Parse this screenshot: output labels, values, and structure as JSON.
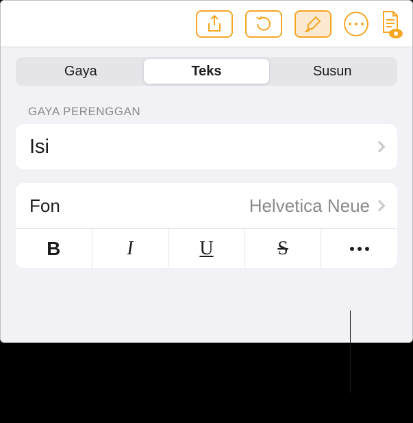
{
  "toolbar": {
    "share_icon": "share-icon",
    "undo_icon": "undo-icon",
    "format_icon": "paintbrush-icon",
    "more_icon": "more-icon",
    "document_icon": "document-view-icon"
  },
  "tabs": {
    "items": [
      {
        "label": "Gaya",
        "selected": false
      },
      {
        "label": "Teks",
        "selected": true
      },
      {
        "label": "Susun",
        "selected": false
      }
    ]
  },
  "paragraph_style": {
    "section_label": "GAYA PERENGGAN",
    "value": "Isi"
  },
  "font": {
    "label": "Fon",
    "value": "Helvetica Neue"
  },
  "style_buttons": {
    "bold": "B",
    "italic": "I",
    "underline": "U",
    "strike": "S"
  }
}
